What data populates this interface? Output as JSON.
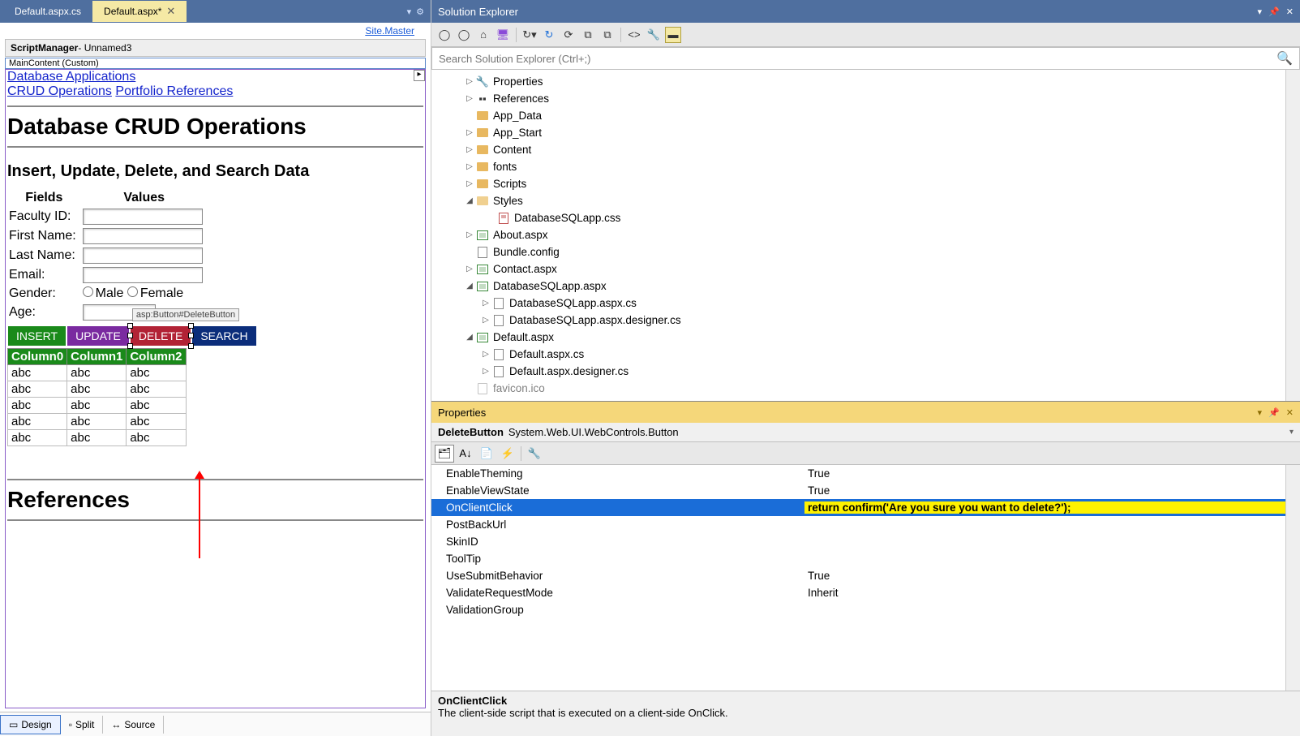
{
  "editor": {
    "tabs": [
      {
        "label": "Default.aspx.cs",
        "active": false
      },
      {
        "label": "Default.aspx*",
        "active": true
      }
    ],
    "site_master": "Site.Master",
    "script_manager": {
      "bold": "ScriptManager",
      "rest": " - Unnamed3"
    },
    "maincontent_tag": "MainContent (Custom)",
    "links": {
      "db_apps": "Database Applications",
      "crud_ops": "CRUD Operations",
      "portfolio": "Portfolio References"
    },
    "h1": "Database CRUD Operations",
    "h2": "Insert, Update, Delete, and Search Data",
    "form": {
      "th_fields": "Fields",
      "th_values": "Values",
      "rows": [
        {
          "label": "Faculty ID:"
        },
        {
          "label": "First Name:"
        },
        {
          "label": "Last Name:"
        },
        {
          "label": "Email:"
        }
      ],
      "gender_label": "Gender:",
      "gender_male": "Male",
      "gender_female": "Female",
      "age_label": "Age:"
    },
    "buttons": {
      "insert": "INSERT",
      "update": "UPDATE",
      "delete": "DELETE",
      "search": "SEARCH",
      "delete_tooltip": "asp:Button#DeleteButton"
    },
    "grid": {
      "headers": [
        "Column0",
        "Column1",
        "Column2"
      ],
      "rows": [
        [
          "abc",
          "abc",
          "abc"
        ],
        [
          "abc",
          "abc",
          "abc"
        ],
        [
          "abc",
          "abc",
          "abc"
        ],
        [
          "abc",
          "abc",
          "abc"
        ],
        [
          "abc",
          "abc",
          "abc"
        ]
      ]
    },
    "references_heading": "References",
    "modes": {
      "design": "Design",
      "split": "Split",
      "source": "Source"
    }
  },
  "solution_explorer": {
    "title": "Solution Explorer",
    "search_placeholder": "Search Solution Explorer (Ctrl+;)",
    "nodes": {
      "properties": "Properties",
      "references": "References",
      "app_data": "App_Data",
      "app_start": "App_Start",
      "content": "Content",
      "fonts": "fonts",
      "scripts": "Scripts",
      "styles": "Styles",
      "styles_css": "DatabaseSQLapp.css",
      "about": "About.aspx",
      "bundle": "Bundle.config",
      "contact": "Contact.aspx",
      "dbsqlapp": "DatabaseSQLapp.aspx",
      "dbsqlapp_cs": "DatabaseSQLapp.aspx.cs",
      "dbsqlapp_des": "DatabaseSQLapp.aspx.designer.cs",
      "default": "Default.aspx",
      "default_cs": "Default.aspx.cs",
      "default_des": "Default.aspx.designer.cs",
      "favicon": "favicon.ico"
    }
  },
  "properties": {
    "title": "Properties",
    "obj_name": "DeleteButton",
    "obj_type": "System.Web.UI.WebControls.Button",
    "rows": [
      {
        "name": "EnableTheming",
        "value": "True"
      },
      {
        "name": "EnableViewState",
        "value": "True"
      },
      {
        "name": "OnClientClick",
        "value": "return confirm('Are you sure you want to delete?');",
        "selected": true
      },
      {
        "name": "PostBackUrl",
        "value": ""
      },
      {
        "name": "SkinID",
        "value": ""
      },
      {
        "name": "ToolTip",
        "value": ""
      },
      {
        "name": "UseSubmitBehavior",
        "value": "True"
      },
      {
        "name": "ValidateRequestMode",
        "value": "Inherit"
      },
      {
        "name": "ValidationGroup",
        "value": ""
      }
    ],
    "desc_title": "OnClientClick",
    "desc_text": "The client-side script that is executed on a client-side OnClick."
  }
}
